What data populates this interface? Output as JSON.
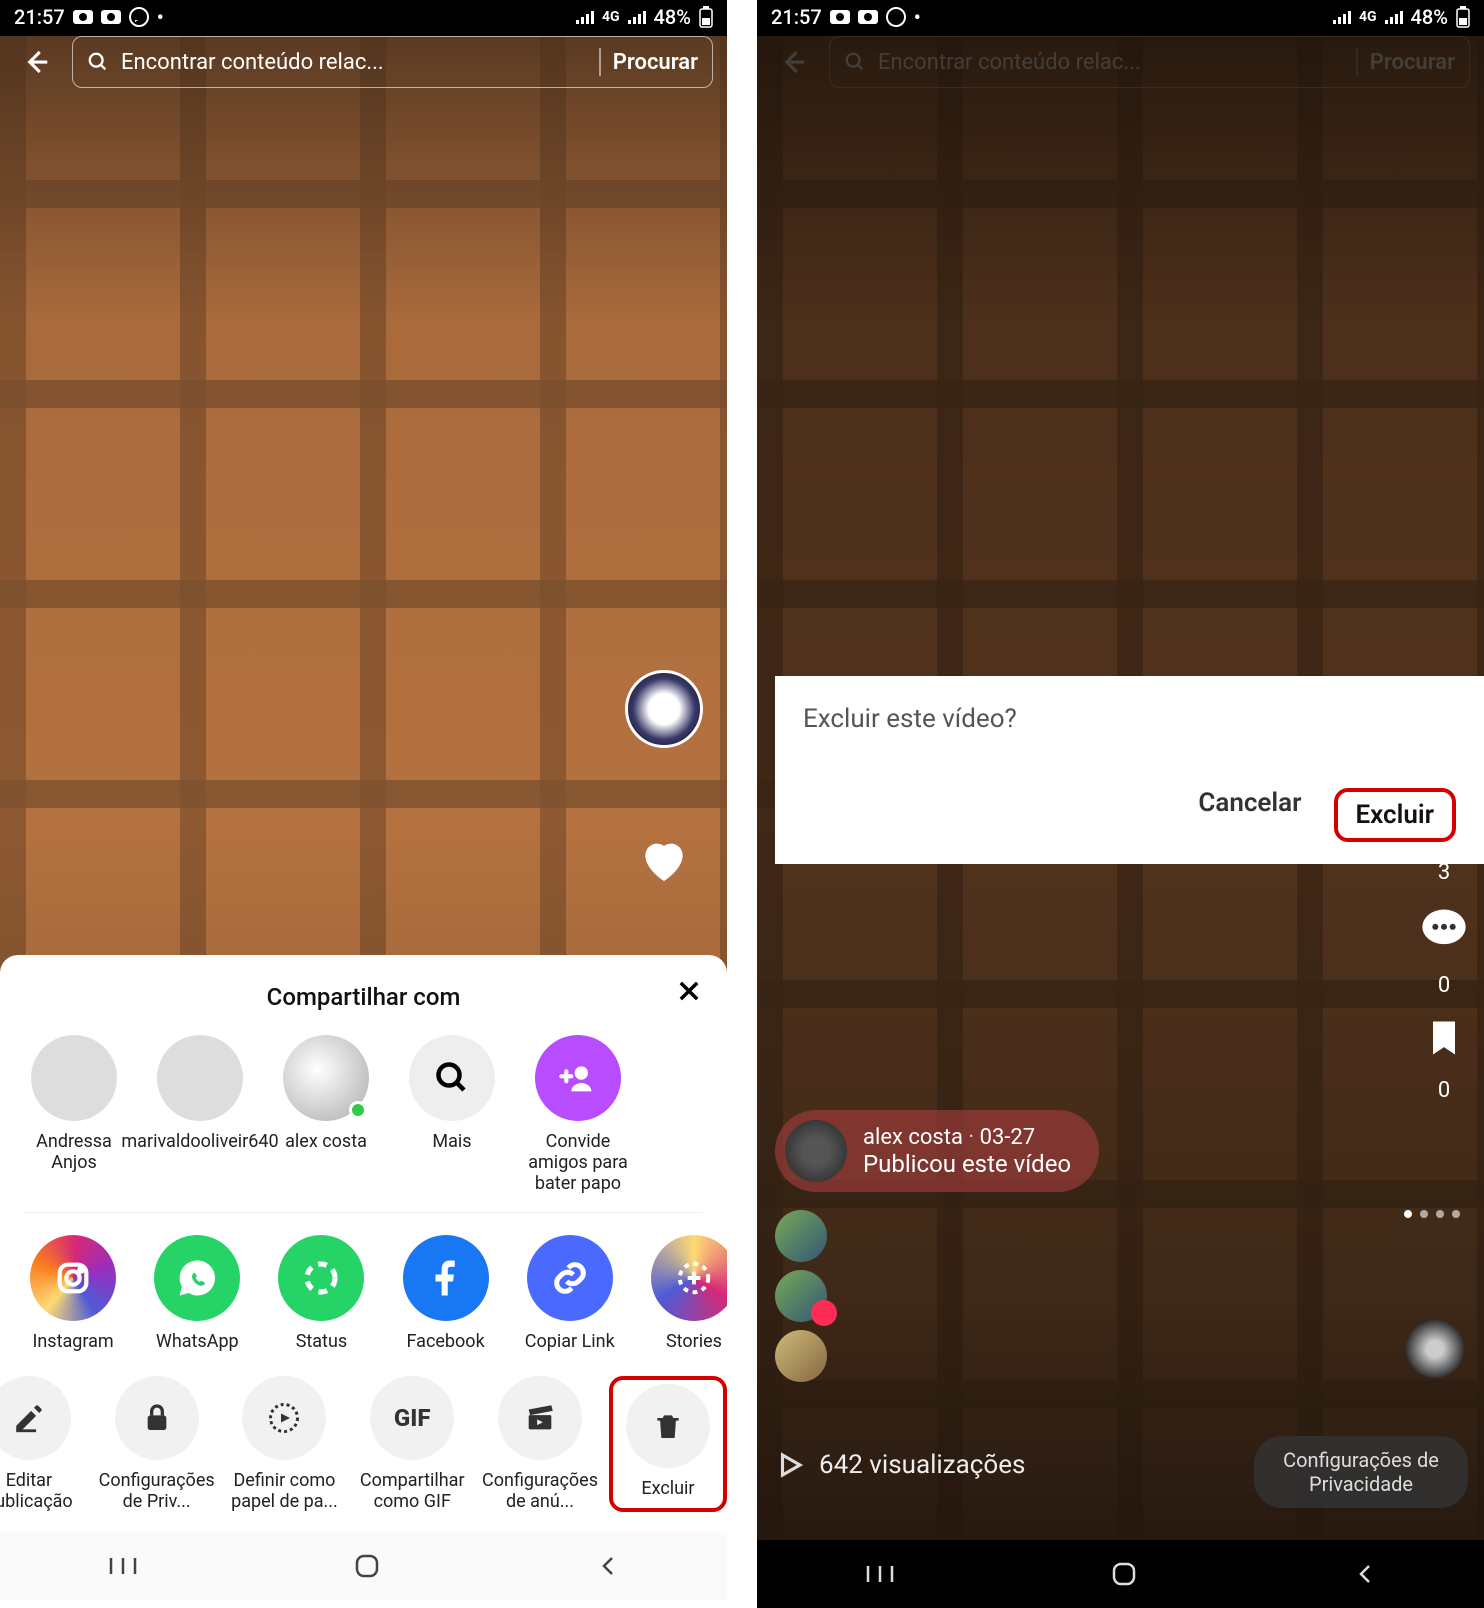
{
  "status": {
    "time": "21:57",
    "battery_text": "48%",
    "net_text": "4G"
  },
  "search": {
    "placeholder": "Encontrar conteúdo relac...",
    "button": "Procurar"
  },
  "sheet": {
    "title": "Compartilhar com",
    "people": [
      {
        "name": "Andressa Anjos"
      },
      {
        "name": "marivaldooliveir640"
      },
      {
        "name": "alex costa"
      },
      {
        "name": "Mais"
      },
      {
        "name": "Convide amigos para bater papo"
      }
    ],
    "apps": [
      {
        "name": "Instagram"
      },
      {
        "name": "WhatsApp"
      },
      {
        "name": "Status"
      },
      {
        "name": "Facebook"
      },
      {
        "name": "Copiar Link"
      },
      {
        "name": "Stories"
      }
    ],
    "actions": [
      {
        "name": "Editar publicação"
      },
      {
        "name": "Configurações de Priv..."
      },
      {
        "name": "Definir como papel de pa..."
      },
      {
        "name": "Compartilhar como GIF"
      },
      {
        "name": "Configurações de anú..."
      },
      {
        "name": "Excluir"
      }
    ]
  },
  "dialog": {
    "title": "Excluir este vídeo?",
    "cancel": "Cancelar",
    "confirm": "Excluir"
  },
  "right": {
    "author": "alex costa",
    "date": "03-27",
    "caption": "Publicou este vídeo",
    "views_text": "642 visualizações",
    "privacy_chip": "Configurações de Privacidade",
    "counts": {
      "likes": "3",
      "comments": "0",
      "saves": "0"
    }
  }
}
